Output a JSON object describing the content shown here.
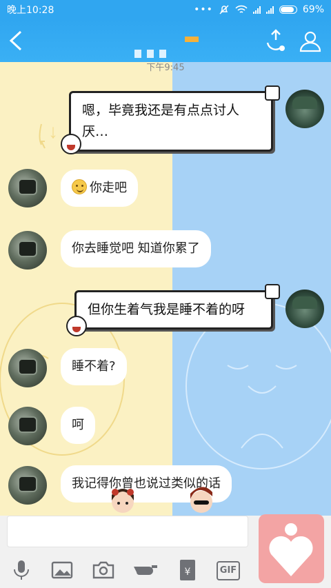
{
  "status_bar": {
    "time": "晚上10:28",
    "battery": "69%",
    "icons": [
      "more-dots-icon",
      "mute-icon",
      "wifi-icon",
      "signal-icon",
      "signal-icon",
      "battery-icon"
    ]
  },
  "header": {
    "back_icon": "chevron-left-icon",
    "call_icon": "phone-icon",
    "profile_icon": "person-icon"
  },
  "chat": {
    "timestamp": "下午9:45",
    "messages": [
      {
        "side": "right",
        "text": "嗯，毕竟我还是有点点讨人厌…"
      },
      {
        "side": "left",
        "emoji": "smile-emoji-icon",
        "text": "你走吧"
      },
      {
        "side": "left",
        "text": "你去睡觉吧 知道你累了"
      },
      {
        "side": "right",
        "text": "但你生着气我是睡不着的呀"
      },
      {
        "side": "left",
        "text": "睡不着?"
      },
      {
        "side": "left",
        "text": "呵"
      },
      {
        "side": "left",
        "text": "我记得你曾也说过类似的话"
      }
    ]
  },
  "input": {
    "placeholder": ""
  },
  "toolbar": {
    "items": [
      "microphone-icon",
      "image-icon",
      "camera-icon",
      "gesture-icon",
      "red-packet-icon",
      "gif-icon"
    ],
    "gif_label": "GIF"
  },
  "colors": {
    "header": "#30a6f0",
    "left_bg": "#fbf1c3",
    "right_bg": "#a7d2f6",
    "fab": "#f3a4a4"
  }
}
